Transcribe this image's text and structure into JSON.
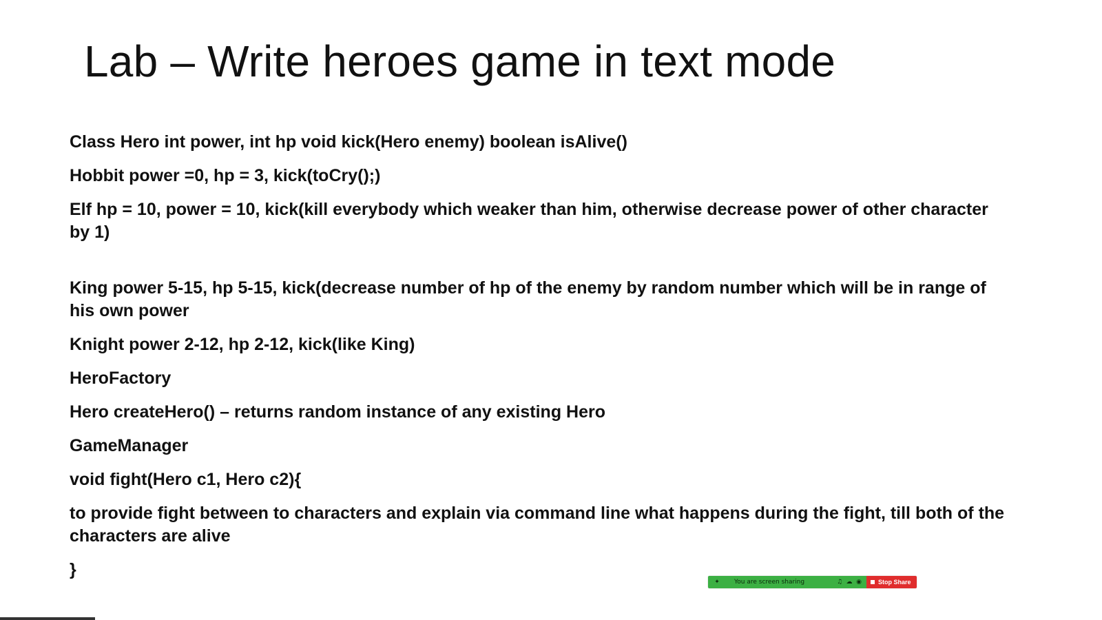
{
  "slide": {
    "title": "Lab – Write heroes game in text mode",
    "paragraphs": [
      "Class Hero int power, int hp void kick(Hero enemy) boolean isAlive()",
      "Hobbit power =0,  hp = 3,  kick(toCry();)",
      "Elf  hp = 10, power = 10, kick(kill everybody which weaker than him, otherwise decrease power of other character by 1)",
      "King  power 5-15,  hp 5-15, kick(decrease number of hp of the enemy by random number which will be in range of his own power",
      "Knight  power 2-12, hp 2-12, kick(like King)",
      "HeroFactory",
      "Hero createHero() – returns random instance of any existing Hero",
      "GameManager",
      "void fight(Hero c1, Hero c2){",
      "to provide fight between to characters and explain via command line what happens during the fight, till both of the characters are alive",
      "}"
    ]
  },
  "share_bar": {
    "status": "You are screen sharing",
    "stop_label": "Stop Share",
    "colors": {
      "bar_green": "#3cb043",
      "stop_red": "#e02d2d"
    },
    "icons": [
      "pin-icon",
      "microphone-icon",
      "cloud-icon",
      "shield-icon",
      "stop-square-icon"
    ]
  }
}
